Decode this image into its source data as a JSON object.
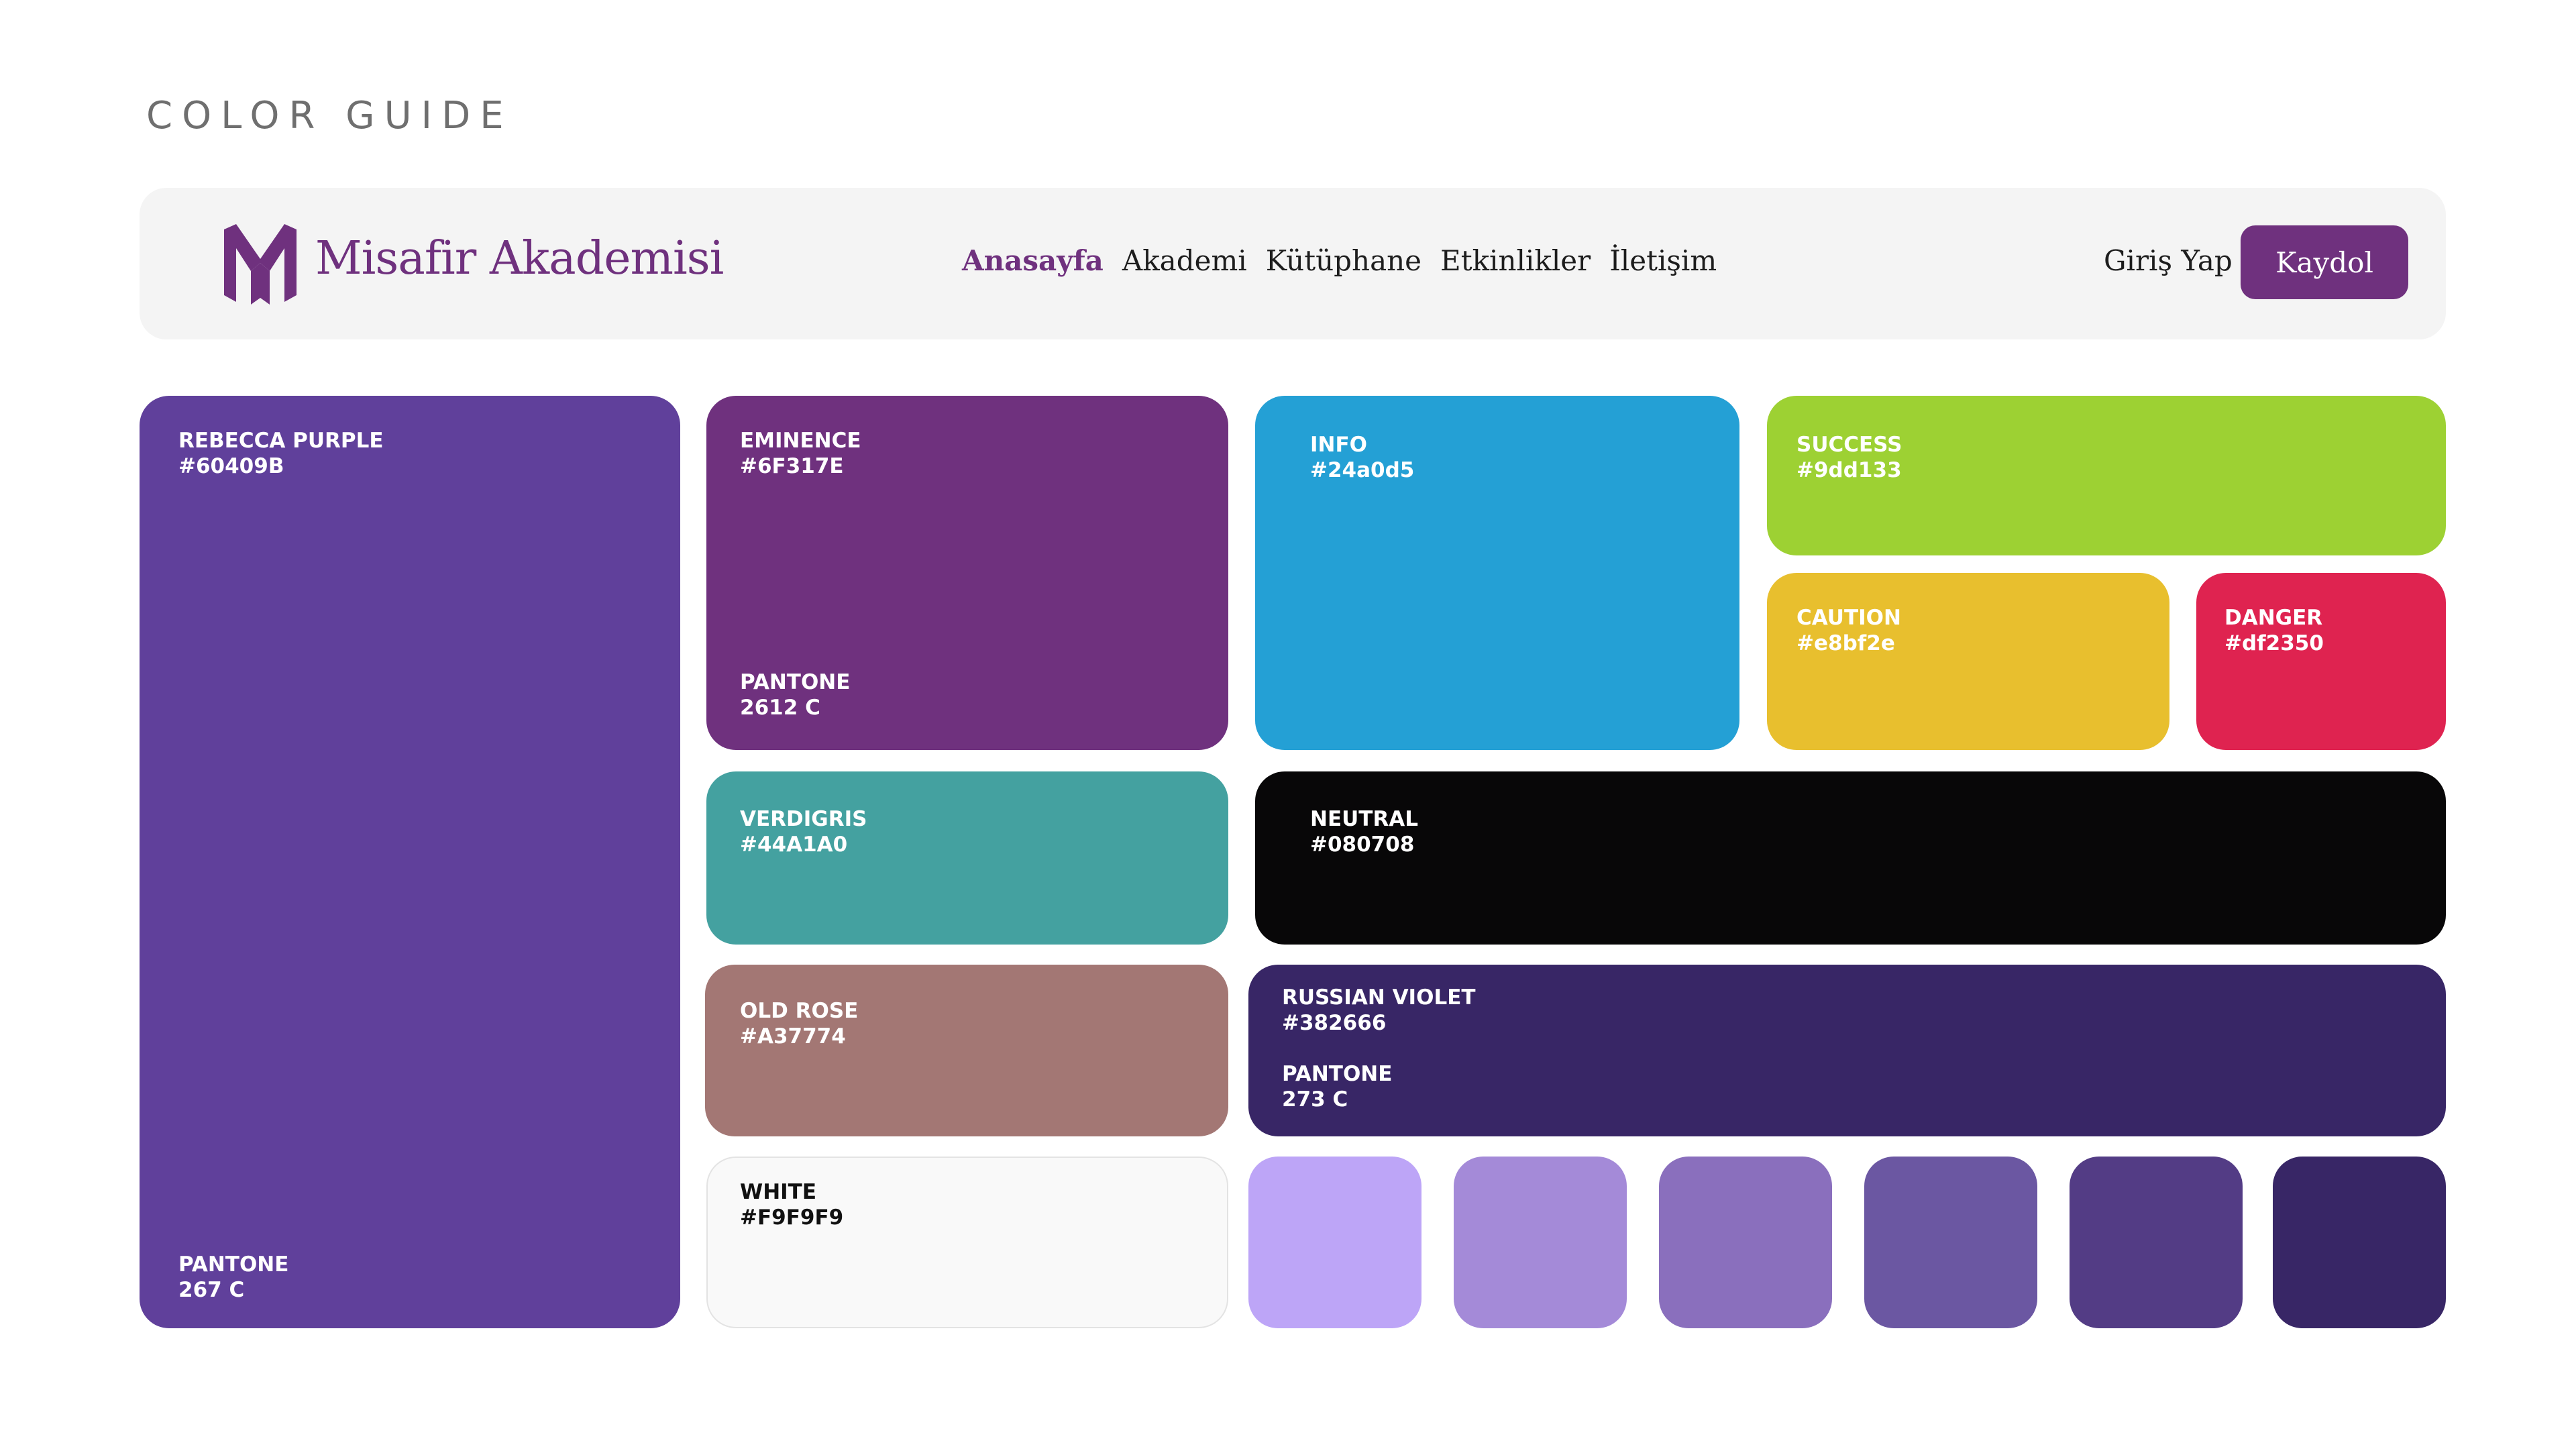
{
  "title": "COLOR GUIDE",
  "navbar": {
    "brand": "Misafir Akademisi",
    "logo_icon": "ma-monogram-icon",
    "links": [
      "Anasayfa",
      "Akademi",
      "Kütüphane",
      "Etkinlikler",
      "İletişim"
    ],
    "active_link": "Anasayfa",
    "login_label": "Giriş Yap",
    "signup_label": "Kaydol"
  },
  "swatches": {
    "rebecca_purple": {
      "name": "REBECCA PURPLE",
      "hex": "#60409B",
      "pantone_label": "PANTONE",
      "pantone_code": "267 C",
      "color": "#60409b"
    },
    "eminence": {
      "name": "EMINENCE",
      "hex": "#6F317E",
      "pantone_label": "PANTONE",
      "pantone_code": "2612 C",
      "color": "#6f317e"
    },
    "info": {
      "name": "INFO",
      "hex": "#24a0d5",
      "color": "#24a0d5"
    },
    "success": {
      "name": "SUCCESS",
      "hex": "#9dd133",
      "color": "#9dd133"
    },
    "caution": {
      "name": "CAUTION",
      "hex": "#e8bf2e",
      "color": "#e8bf2e"
    },
    "danger": {
      "name": "DANGER",
      "hex": "#df2350",
      "color": "#df2350"
    },
    "verdigris": {
      "name": "VERDIGRIS",
      "hex": "#44A1A0",
      "color": "#44a1a0"
    },
    "neutral": {
      "name": "NEUTRAL",
      "hex": "#080708",
      "color": "#080708"
    },
    "old_rose": {
      "name": "OLD ROSE",
      "hex": "#A37774",
      "color": "#a37774"
    },
    "russian_violet": {
      "name": "RUSSIAN VIOLET",
      "hex": "#382666",
      "pantone_label": "PANTONE",
      "pantone_code": "273 C",
      "color": "#382666"
    },
    "white": {
      "name": "WHITE",
      "hex": "#F9F9F9",
      "color": "#f9f9f9"
    }
  },
  "tints": [
    "#bda5f7",
    "#a48ad8",
    "#8a6fbd",
    "#6b57a2",
    "#533c85",
    "#382666"
  ]
}
